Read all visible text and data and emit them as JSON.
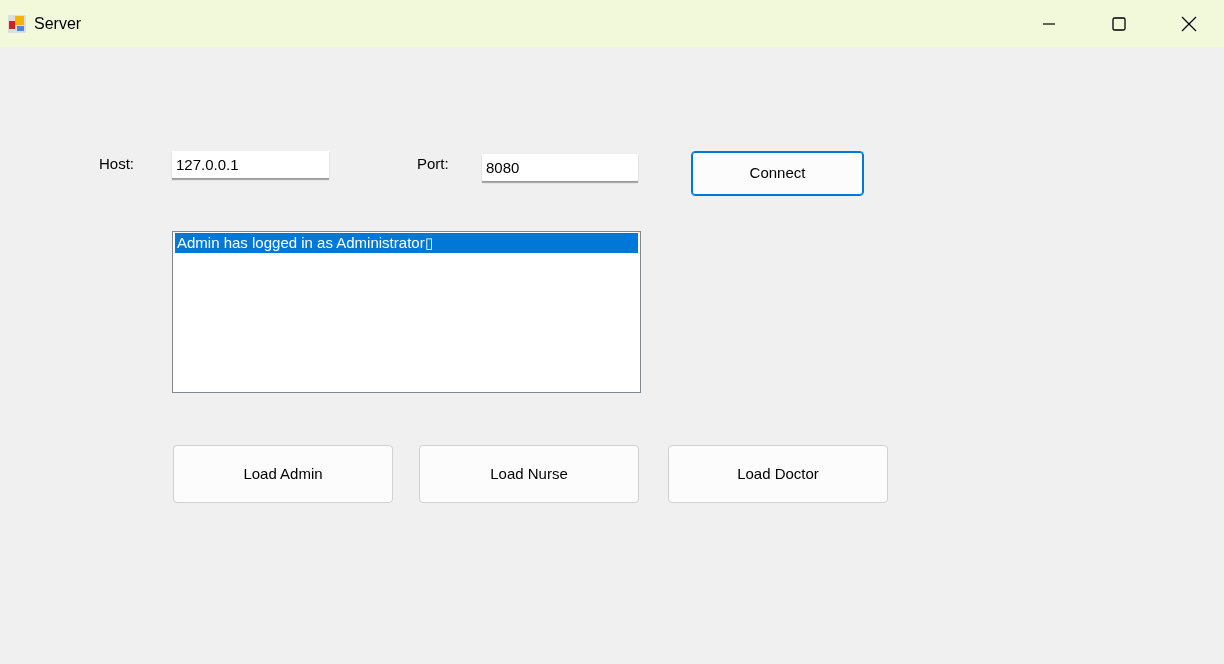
{
  "window": {
    "title": "Server"
  },
  "host": {
    "label": "Host:",
    "value": "127.0.0.1"
  },
  "port": {
    "label": "Port:",
    "value": "8080"
  },
  "connect_button": "Connect",
  "log": [
    {
      "text": "Admin has logged in as Administrator▯",
      "selected": true
    }
  ],
  "buttons": [
    "Load Admin",
    "Load Nurse",
    "Load Doctor"
  ]
}
